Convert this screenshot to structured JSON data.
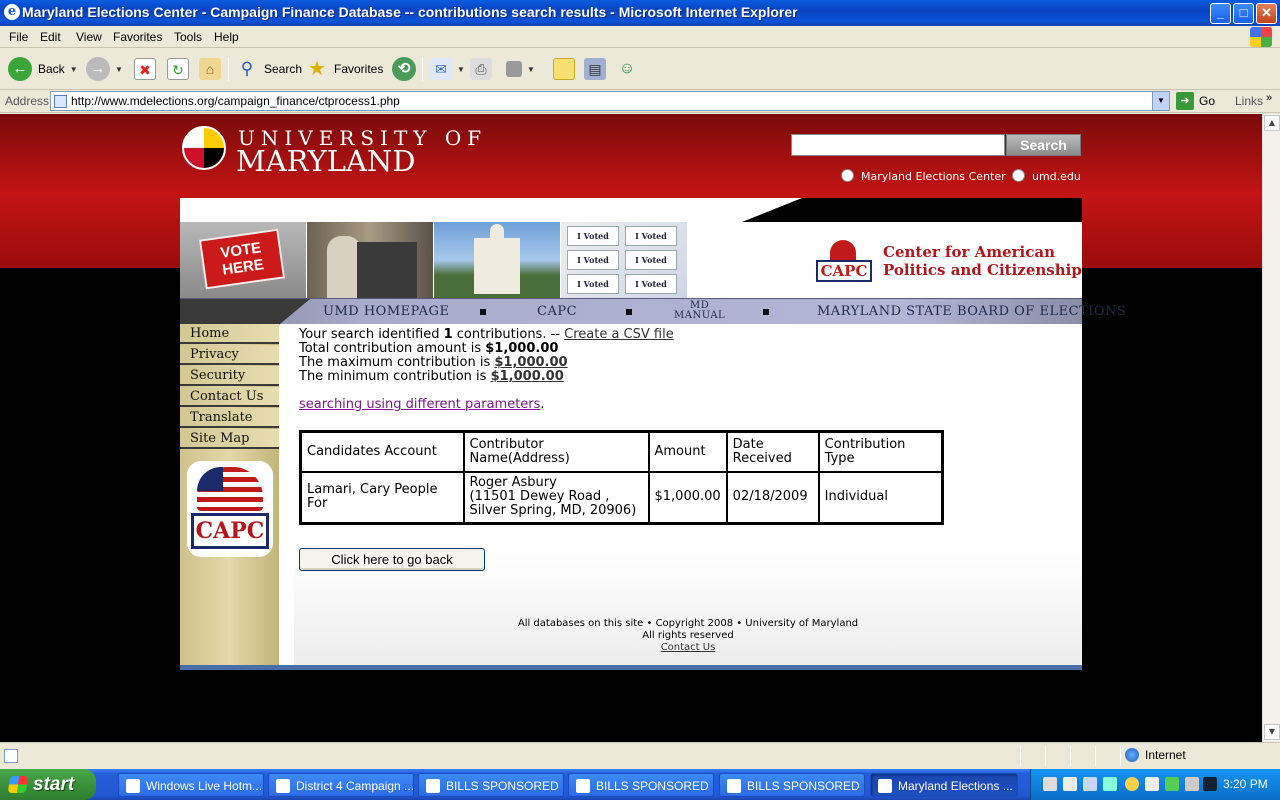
{
  "window": {
    "title": "Maryland Elections Center - Campaign Finance Database -- contributions search results - Microsoft Internet Explorer",
    "controls": [
      "_",
      "□",
      "✕"
    ]
  },
  "menu": [
    "File",
    "Edit",
    "View",
    "Favorites",
    "Tools",
    "Help"
  ],
  "toolbar": {
    "back": "Back",
    "search": "Search",
    "favorites": "Favorites"
  },
  "address": {
    "label": "Address",
    "url": "http://www.mdelections.org/campaign_finance/ctprocess1.php",
    "go": "Go",
    "links": "Links"
  },
  "header": {
    "univ_small": "UNIVERSITY OF",
    "univ_big": "MARYLAND",
    "search_button": "Search",
    "radio1": "Maryland Elections Center",
    "radio2": "umd.edu"
  },
  "banner": {
    "vote_sign": "VOTE HERE",
    "sticker": "I Voted",
    "capc_short": "CAPC",
    "capc_title_1": "Center for American",
    "capc_title_2": "Politics and Citizenship"
  },
  "nav": {
    "umd": "UMD HOMEPAGE",
    "capc": "CAPC",
    "md1": "MD",
    "md2": "MANUAL",
    "sbe": "MARYLAND STATE BOARD OF ELECTIONS"
  },
  "sidebar": {
    "items": [
      "Home",
      "Privacy",
      "Security",
      "Contact Us",
      "Translate",
      "Site Map"
    ],
    "logo_text": "CAPC"
  },
  "summary": {
    "prefix": "Your search identified ",
    "count": "1",
    "mid": " contributions. -- ",
    "csv_link": "Create a CSV file",
    "total_label": "Total contribution amount is ",
    "total": "$1,000.00",
    "max_label": "The maximum contribution is ",
    "max": "$1,000.00",
    "min_label": "The minimum contribution is ",
    "min": "$1,000.00",
    "search_again": "searching using different parameters",
    "search_again_suffix": "."
  },
  "table": {
    "headers": [
      "Candidates Account",
      "Contributor Name(Address)",
      "Amount",
      "Date Received",
      "Contribution Type"
    ],
    "rows": [
      {
        "account": "Lamari, Cary People For",
        "name": "Roger Asbury",
        "addr1": "(11501 Dewey Road ,",
        "addr2": "Silver Spring, MD, 20906)",
        "amount": "$1,000.00",
        "date": "02/18/2009",
        "type": "Individual"
      }
    ]
  },
  "back_button": "Click here to go back",
  "footer": {
    "line1": "All databases on this site • Copyright 2008 • University of Maryland",
    "line2": "All rights reserved",
    "contact": "Contact Us"
  },
  "status": {
    "zone": "Internet"
  },
  "taskbar": {
    "start": "start",
    "tasks": [
      "Windows Live Hotm...",
      "District 4 Campaign ...",
      "BILLS SPONSORED ...",
      "BILLS SPONSORED ...",
      "BILLS SPONSORED ...",
      "Maryland Elections ..."
    ],
    "clock": "3:20 PM"
  }
}
